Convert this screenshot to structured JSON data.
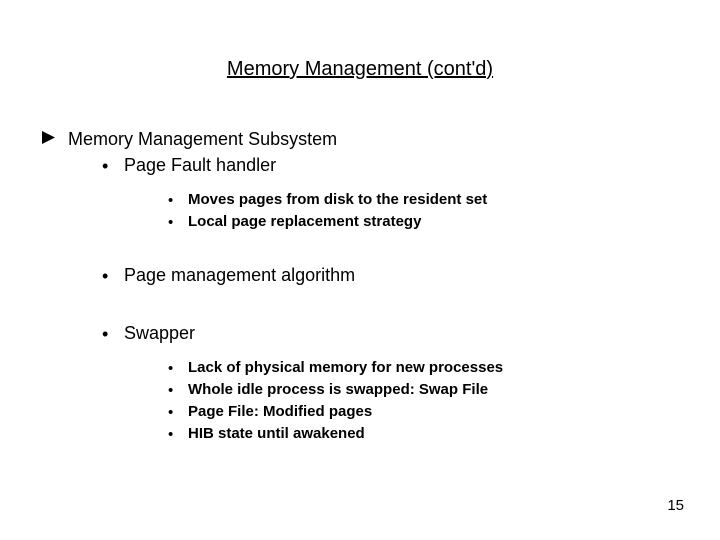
{
  "title": "Memory Management (cont'd)",
  "level1": {
    "text": "Memory Management Subsystem"
  },
  "level2_a": "Page Fault handler",
  "level3_a1": "Moves pages from disk to the resident set",
  "level3_a2": "Local page replacement strategy",
  "level2_b": "Page management algorithm",
  "level2_c": "Swapper",
  "level3_c1": "Lack of physical memory for new processes",
  "level3_c2": "Whole idle process is swapped: Swap File",
  "level3_c3": "Page File: Modified pages",
  "level3_c4": "HIB state until awakened",
  "page_number": "15"
}
